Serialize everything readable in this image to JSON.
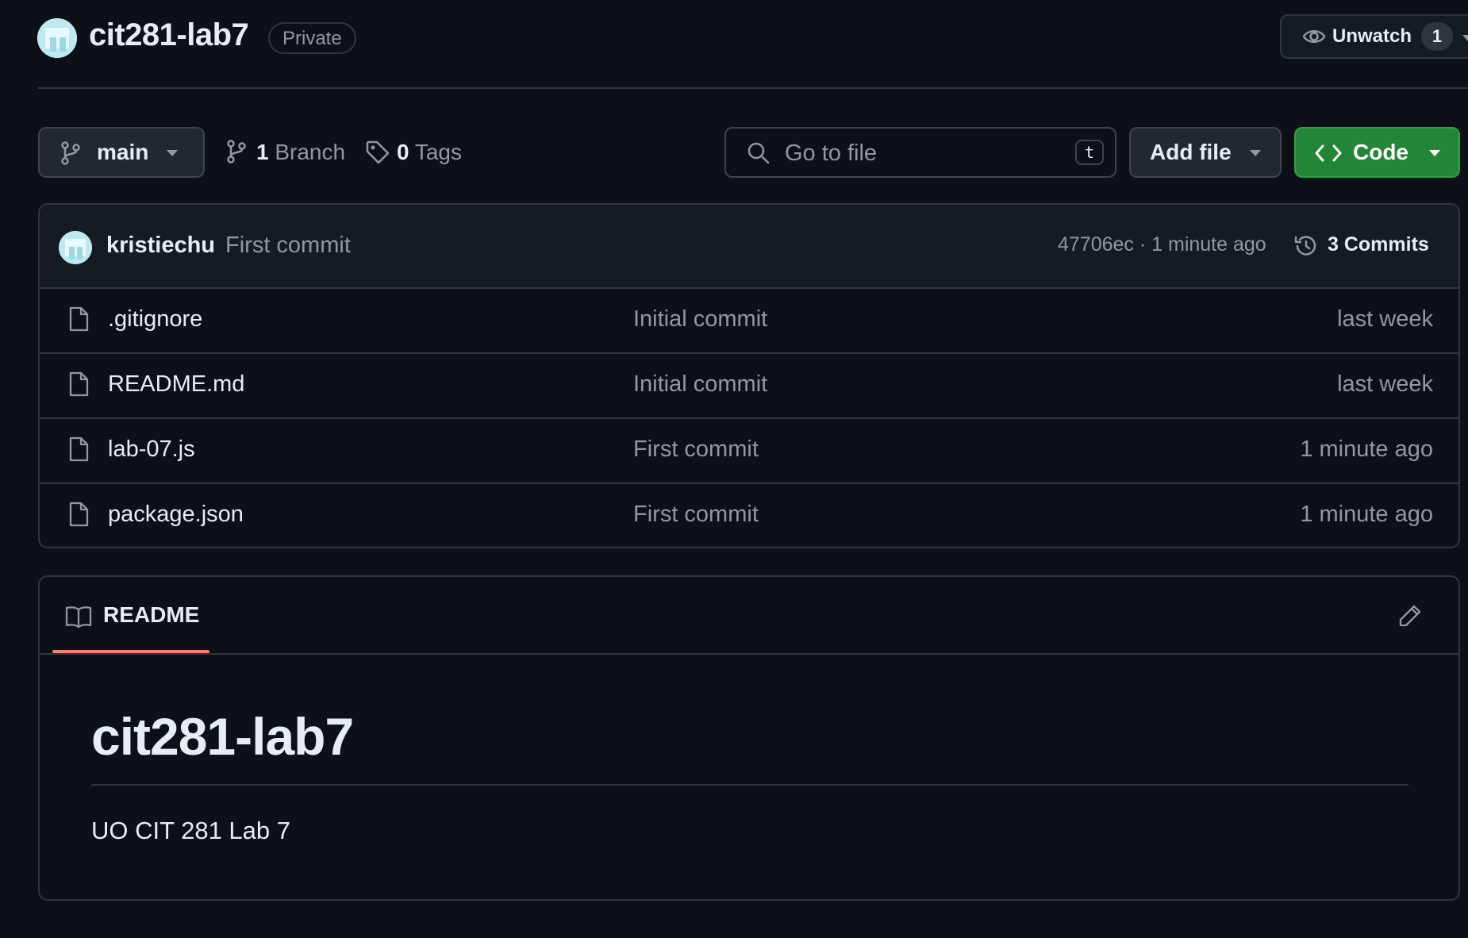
{
  "header": {
    "repo_name": "cit281-lab7",
    "visibility": "Private",
    "watch_label": "Unwatch",
    "watch_count": "1"
  },
  "toolbar": {
    "branch": "main",
    "branch_count": "1",
    "branch_label": "Branch",
    "tag_count": "0",
    "tag_label": "Tags",
    "search_placeholder": "Go to file",
    "search_shortcut": "t",
    "add_file_label": "Add file",
    "code_label": "Code"
  },
  "commit": {
    "author": "kristiechu",
    "message": "First commit",
    "meta": "47706ec · 1 minute ago",
    "commits_label": "3 Commits"
  },
  "files": [
    {
      "name": ".gitignore",
      "message": "Initial commit",
      "time": "last week"
    },
    {
      "name": "README.md",
      "message": "Initial commit",
      "time": "last week"
    },
    {
      "name": "lab-07.js",
      "message": "First commit",
      "time": "1 minute ago"
    },
    {
      "name": "package.json",
      "message": "First commit",
      "time": "1 minute ago"
    }
  ],
  "readme": {
    "tab_label": "README",
    "heading": "cit281-lab7",
    "body": "UO CIT 281 Lab 7"
  },
  "colors": {
    "background": "#0d1117",
    "code_button": "#238636",
    "readme_tab_underline": "#f78166"
  },
  "icons": [
    "avatar",
    "eye-icon",
    "branch-icon",
    "tag-icon",
    "search-icon",
    "code-icon",
    "history-icon",
    "file-icon",
    "book-icon",
    "pencil-icon"
  ]
}
